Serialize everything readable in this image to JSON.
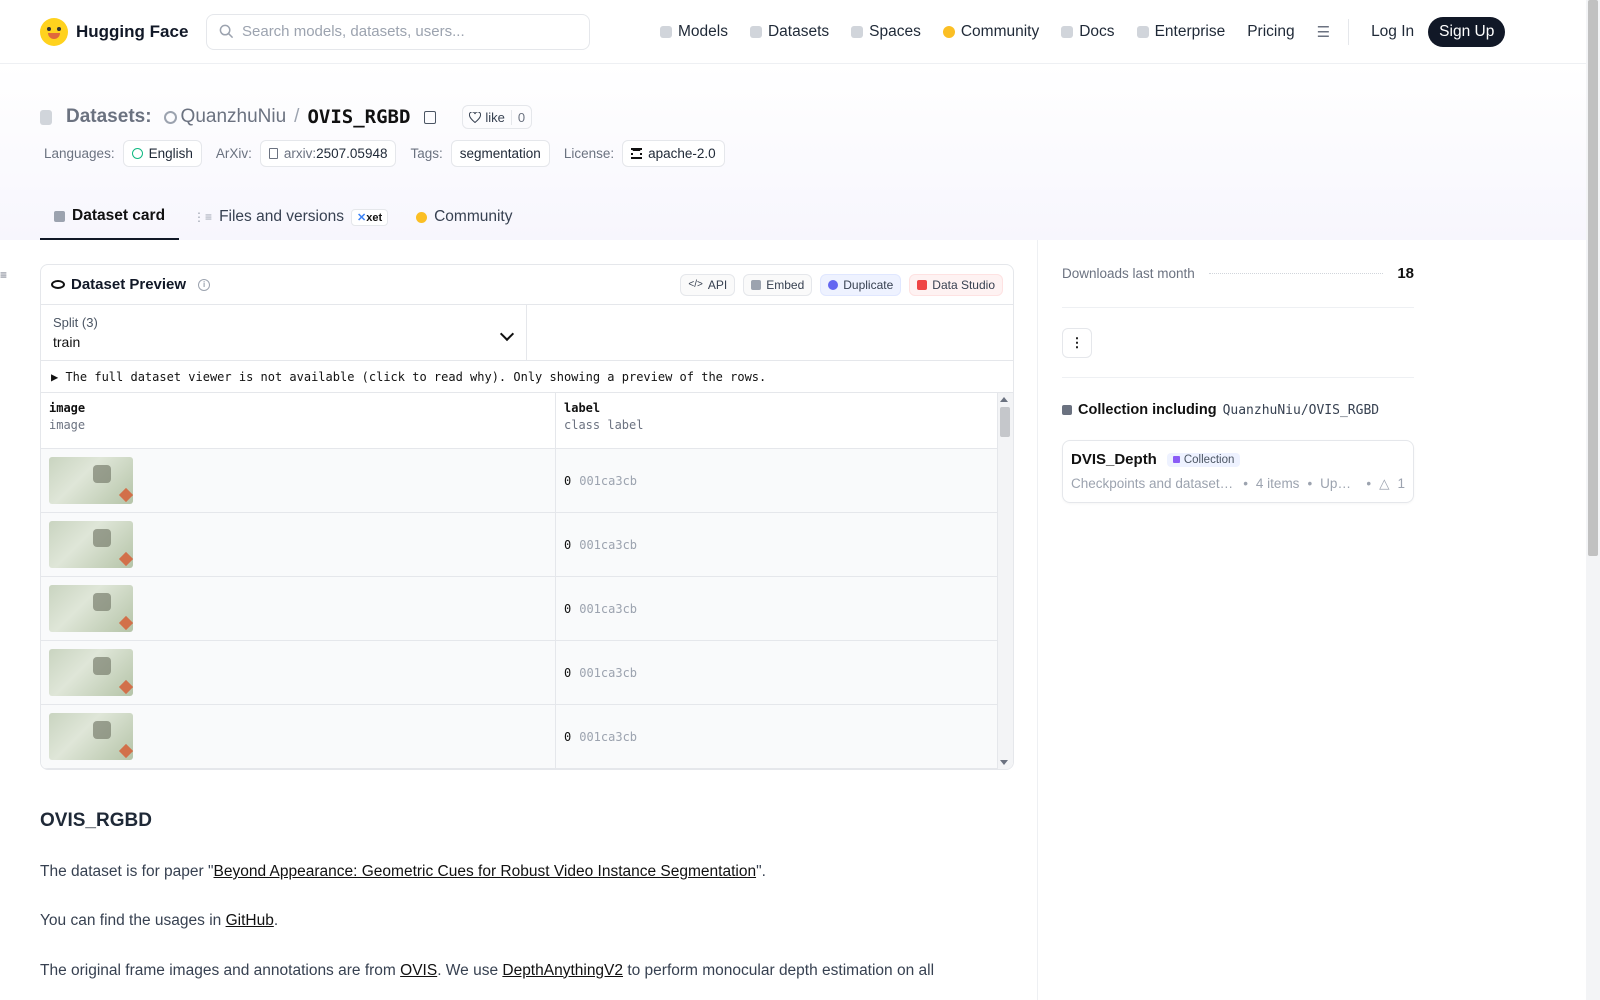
{
  "header": {
    "brand": "Hugging Face",
    "search_placeholder": "Search models, datasets, users...",
    "nav": [
      "Models",
      "Datasets",
      "Spaces",
      "Community",
      "Docs",
      "Enterprise",
      "Pricing"
    ],
    "login": "Log In",
    "signup": "Sign Up"
  },
  "repo": {
    "type_label": "Datasets:",
    "owner": "QuanzhuNiu",
    "separator": "/",
    "name": "OVIS_RGBD",
    "like_label": "like",
    "like_count": "0",
    "languages_label": "Languages:",
    "language": "English",
    "arxiv_label": "ArXiv:",
    "arxiv_prefix": "arxiv:",
    "arxiv_id": "2507.05948",
    "tags_label": "Tags:",
    "tag": "segmentation",
    "license_label": "License:",
    "license": "apache-2.0"
  },
  "tabs": {
    "card": "Dataset card",
    "files": "Files and versions",
    "xet": "xet",
    "community": "Community"
  },
  "preview": {
    "title": "Dataset Preview",
    "api": "API",
    "embed": "Embed",
    "duplicate": "Duplicate",
    "studio": "Data Studio",
    "split_label": "Split (3)",
    "split_value": "train",
    "notice": "▶ The full dataset viewer is not available (click to read why). Only showing a preview of the rows.",
    "col1_name": "image",
    "col1_type": "image",
    "col2_name": "label",
    "col2_type": "class label",
    "rows": [
      {
        "num": "0",
        "label": "001ca3cb"
      },
      {
        "num": "0",
        "label": "001ca3cb"
      },
      {
        "num": "0",
        "label": "001ca3cb"
      },
      {
        "num": "0",
        "label": "001ca3cb"
      },
      {
        "num": "0",
        "label": "001ca3cb"
      }
    ]
  },
  "card": {
    "heading": "OVIS_RGBD",
    "p1_pre": "The dataset is for paper \"",
    "p1_link": "Beyond Appearance: Geometric Cues for Robust Video Instance Segmentation",
    "p1_post": "\".",
    "p2_pre": "You can find the usages in ",
    "p2_link": "GitHub",
    "p2_post": ".",
    "p3_a": "The original frame images and annotations are from ",
    "p3_link1": "OVIS",
    "p3_b": ". We use ",
    "p3_link2": "DepthAnythingV2",
    "p3_c": " to perform monocular depth estimation on all"
  },
  "sidebar": {
    "downloads_label": "Downloads last month",
    "downloads_value": "18",
    "kebab": "⋮",
    "collection_label": "Collection including",
    "collection_repo": "QuanzhuNiu/OVIS_RGBD",
    "collection_name": "DVIS_Depth",
    "collection_badge": "Collection",
    "collection_desc": "Checkpoints and datasets of paper",
    "collection_items": "4 items",
    "collection_updated": "Updated",
    "collection_upvotes": "1"
  }
}
